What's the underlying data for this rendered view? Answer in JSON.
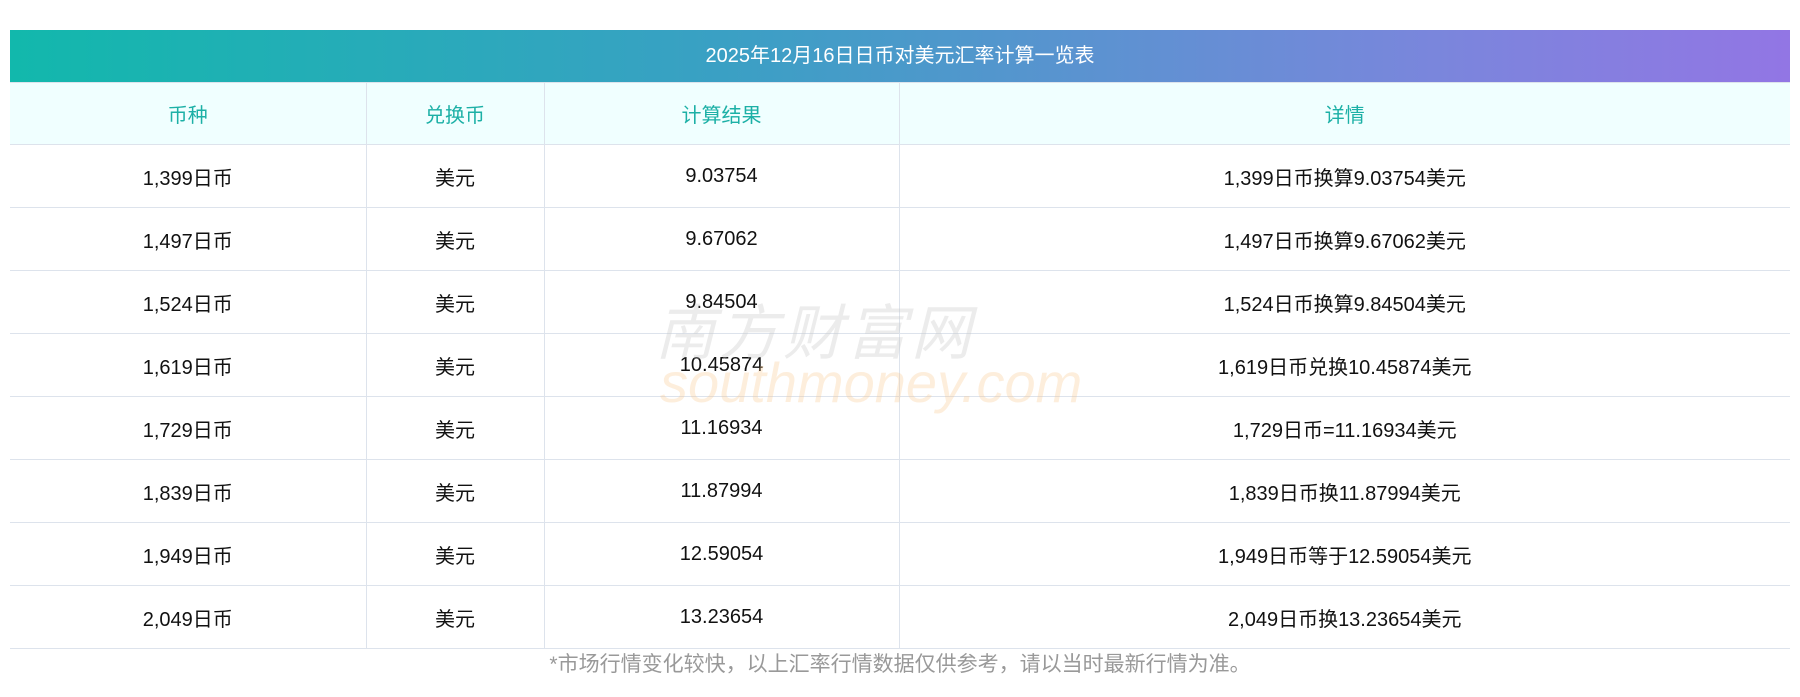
{
  "title": "2025年12月16日日币对美元汇率计算一览表",
  "headers": [
    "币种",
    "兑换币",
    "计算结果",
    "详情"
  ],
  "rows": [
    [
      "1,399日币",
      "美元",
      "9.03754",
      "1,399日币换算9.03754美元"
    ],
    [
      "1,497日币",
      "美元",
      "9.67062",
      "1,497日币换算9.67062美元"
    ],
    [
      "1,524日币",
      "美元",
      "9.84504",
      "1,524日币换算9.84504美元"
    ],
    [
      "1,619日币",
      "美元",
      "10.45874",
      "1,619日币兑换10.45874美元"
    ],
    [
      "1,729日币",
      "美元",
      "11.16934",
      "1,729日币=11.16934美元"
    ],
    [
      "1,839日币",
      "美元",
      "11.87994",
      "1,839日币换11.87994美元"
    ],
    [
      "1,949日币",
      "美元",
      "12.59054",
      "1,949日币等于12.59054美元"
    ],
    [
      "2,049日币",
      "美元",
      "13.23654",
      "2,049日币换13.23654美元"
    ]
  ],
  "note": "*市场行情变化较快，以上汇率行情数据仅供参考，请以当时最新行情为准。",
  "watermark": {
    "cn": "南方财富网",
    "en": "southmoney.com"
  }
}
